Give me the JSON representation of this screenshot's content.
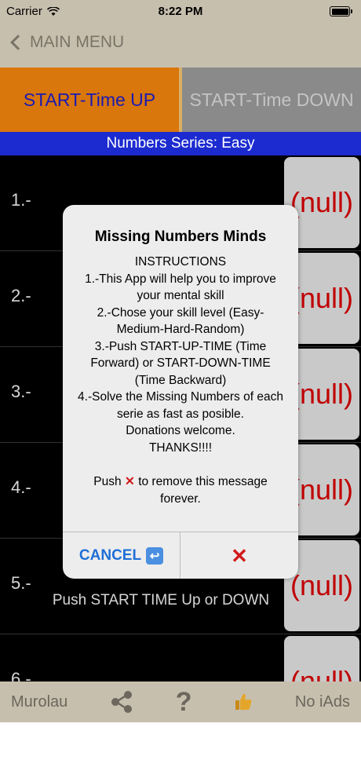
{
  "status_bar": {
    "carrier": "Carrier",
    "time": "8:22 PM"
  },
  "nav": {
    "back_label": "MAIN MENU"
  },
  "start_buttons": {
    "up_label": "START-Time UP",
    "down_label": "START-Time DOWN"
  },
  "series_label": "Numbers Series: Easy",
  "rows": [
    {
      "number": "1.-",
      "value": "(null)"
    },
    {
      "number": "2.-",
      "value": "(null)"
    },
    {
      "number": "3.-",
      "value": "(null)"
    },
    {
      "number": "4.-",
      "value": "(null)"
    },
    {
      "number": "5.-",
      "value": "(null)"
    },
    {
      "number": "6.-",
      "value": "(null)"
    }
  ],
  "hint": "Push START TIME Up or DOWN",
  "toolbar": {
    "left_label": "Murolau",
    "right_label": "No iAds",
    "help_glyph": "?"
  },
  "modal": {
    "title": "Missing Numbers Minds",
    "heading": "INSTRUCTIONS",
    "lines": [
      "1.-This App will help you to improve your mental skill",
      "2.-Chose your skill level (Easy-Medium-Hard-Random)",
      "3.-Push START-UP-TIME (Time Forward) or START-DOWN-TIME (Time Backward)",
      "4.-Solve the Missing Numbers of each serie as fast as posible.",
      "Donations welcome.",
      "THANKS!!!!"
    ],
    "push_prefix": "Push",
    "push_glyph": "✕",
    "push_suffix": "to remove this message forever.",
    "cancel_label": "CANCEL",
    "confirm_glyph": "✕"
  },
  "colors": {
    "accent_orange": "#d9760c",
    "series_blue": "#1c2bd0",
    "null_red": "#c00000"
  }
}
